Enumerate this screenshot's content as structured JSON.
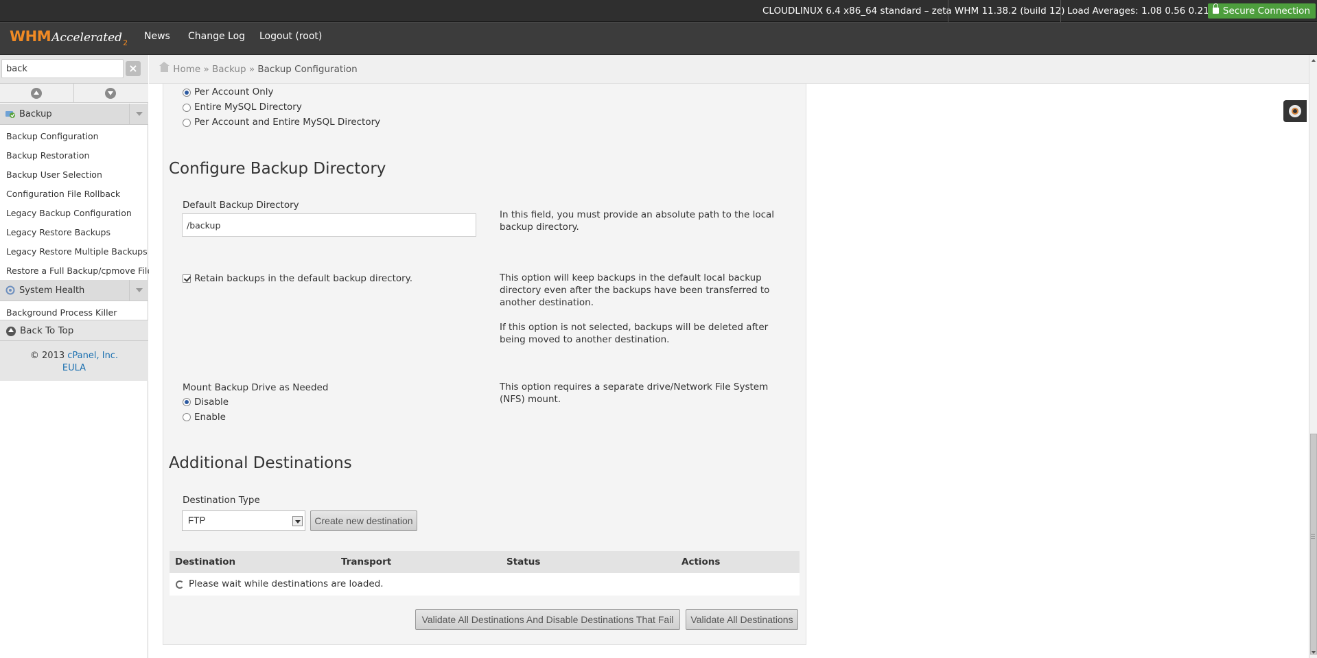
{
  "statusbar": {
    "os": "CLOUDLINUX 6.4 x86_64 standard – zeta",
    "whm_version": "WHM 11.38.2 (build 12)",
    "load_averages": "Load Averages: 1.08 0.56 0.21",
    "secure": "Secure Connection"
  },
  "header": {
    "logo_whm": "WHM",
    "logo_accelerated": "Accelerated",
    "logo_sub": "2",
    "nav": [
      "News",
      "Change Log",
      "Logout (root)"
    ]
  },
  "sidebar": {
    "search_value": "back",
    "groups": [
      {
        "label": "Backup",
        "icon": "backup-icon"
      },
      {
        "label": "System Health",
        "icon": "system-health-icon"
      }
    ],
    "backup_items": [
      "Backup Configuration",
      "Backup Restoration",
      "Backup User Selection",
      "Configuration File Rollback",
      "Legacy Backup Configuration",
      "Legacy Restore Backups",
      "Legacy Restore Multiple Backups",
      "Restore a Full Backup/cpmove File"
    ],
    "health_items": [
      "Background Process Killer"
    ],
    "back_to_top": "Back To Top",
    "copyright_prefix": "© 2013 ",
    "copyright_link": "cPanel, Inc.",
    "eula": "EULA"
  },
  "breadcrumb": {
    "home": "Home",
    "sep": "»",
    "backup": "Backup",
    "current": "Backup Configuration"
  },
  "content": {
    "mysql_options": [
      {
        "label": "Per Account Only",
        "checked": true
      },
      {
        "label": "Entire MySQL Directory",
        "checked": false
      },
      {
        "label": "Per Account and Entire MySQL Directory",
        "checked": false
      }
    ],
    "directory_heading": "Configure Backup Directory",
    "default_dir_label": "Default Backup Directory",
    "default_dir_value": "/backup",
    "default_dir_help": "In this field, you must provide an absolute path to the local backup directory.",
    "retain_label": "Retain backups in the default backup directory.",
    "retain_checked": true,
    "retain_help_1": "This option will keep backups in the default local backup directory even after the backups have been transferred to another destination.",
    "retain_help_2": "If this option is not selected, backups will be deleted after being moved to another destination.",
    "mount_label": "Mount Backup Drive as Needed",
    "mount_options": [
      {
        "label": "Disable",
        "checked": true
      },
      {
        "label": "Enable",
        "checked": false
      }
    ],
    "mount_help": "This option requires a separate drive/Network File System (NFS) mount.",
    "destinations_heading": "Additional Destinations",
    "destination_type_label": "Destination Type",
    "destination_type_value": "FTP",
    "create_button": "Create new destination",
    "table_headers": [
      "Destination",
      "Transport",
      "Status",
      "Actions"
    ],
    "loading_text": "Please wait while destinations are loaded.",
    "validate_disable_button": "Validate All Destinations And Disable Destinations That Fail",
    "validate_button": "Validate All Destinations"
  }
}
